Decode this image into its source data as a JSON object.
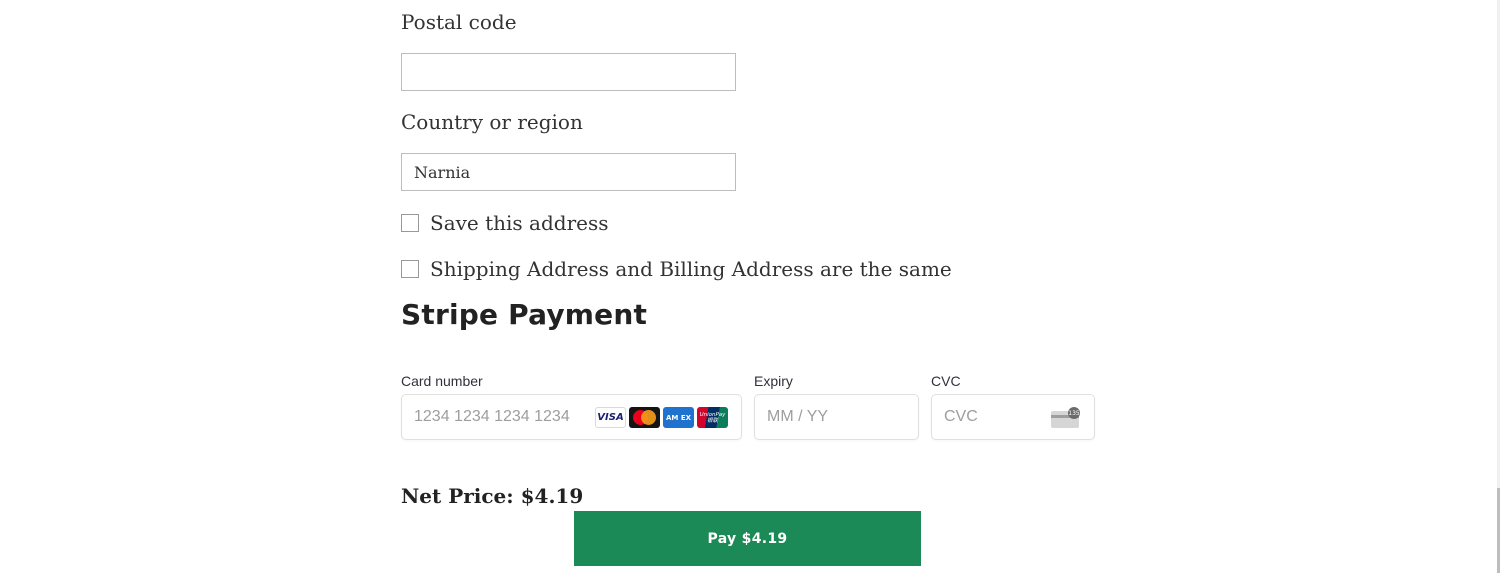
{
  "postal": {
    "label": "Postal code",
    "value": ""
  },
  "country": {
    "label": "Country or region",
    "value": "Narnia"
  },
  "save_address": {
    "label": "Save this address",
    "checked": false
  },
  "same_address": {
    "label": "Shipping Address and Billing Address are the same",
    "checked": false
  },
  "stripe": {
    "heading": "Stripe Payment",
    "card_number": {
      "label": "Card number",
      "placeholder": "1234 1234 1234 1234"
    },
    "brands": [
      "VISA",
      "mastercard-icon",
      "AMEX",
      "UnionPay"
    ],
    "brand_text": {
      "visa": "VISA",
      "amex": "AM EX",
      "unionpay": "UnionPay 银联"
    },
    "expiry": {
      "label": "Expiry",
      "placeholder": "MM / YY"
    },
    "cvc": {
      "label": "CVC",
      "placeholder": "CVC",
      "icon_text": "135"
    }
  },
  "summary": {
    "net_price": "Net Price: $4.19"
  },
  "pay_button": {
    "label": "Pay $4.19",
    "color": "#1c8a57"
  }
}
